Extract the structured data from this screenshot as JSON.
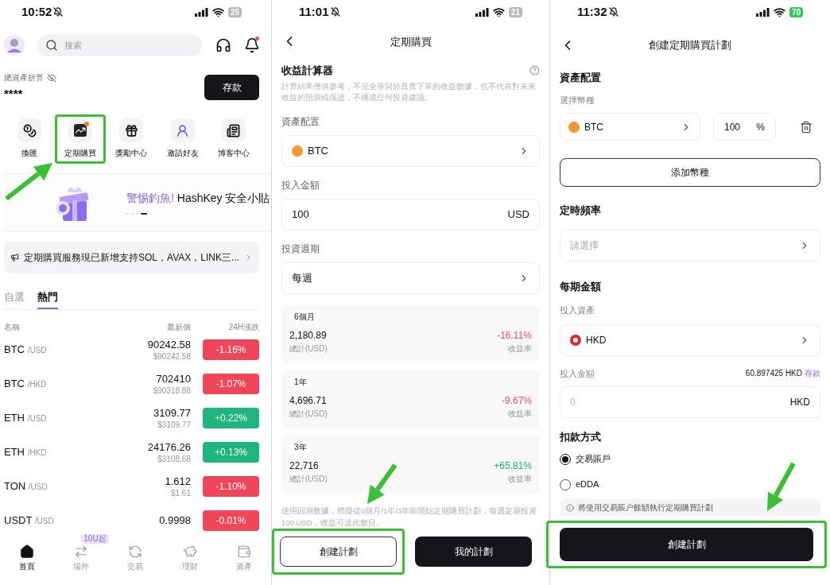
{
  "home_screen": {
    "status_bar": {
      "time": "10:52",
      "battery": "25",
      "charging": false
    },
    "search": {
      "placeholder": "搜索"
    },
    "bell_unread": true,
    "assets": {
      "label": "總資產折算",
      "value": "****",
      "deposit_button": "存款"
    },
    "shortcuts": [
      {
        "label": "換匯",
        "kind": "exchange",
        "highlighted": false
      },
      {
        "label": "定期購買",
        "kind": "recurring",
        "highlighted": true
      },
      {
        "label": "獎勵中心",
        "kind": "rewards",
        "highlighted": false
      },
      {
        "label": "邀請好友",
        "kind": "invite",
        "highlighted": false
      },
      {
        "label": "博客中心",
        "kind": "blog",
        "highlighted": false
      }
    ],
    "banner": {
      "accent": "警惕釣魚!",
      "text": "HashKey 安全小貼",
      "pager": [
        {
          "selected": false
        },
        {
          "selected": false
        },
        {
          "selected": false
        },
        {
          "selected": true
        }
      ]
    },
    "notice": "定期購買服務現已新增支持SOL，AVAX，LINK三...",
    "tabs": [
      {
        "label": "自選",
        "selected": false
      },
      {
        "label": "熱門",
        "selected": true
      }
    ],
    "table": {
      "columns": [
        "名稱",
        "最新價",
        "24H漲跌"
      ],
      "rows": [
        {
          "symbol": "BTC",
          "quote": "/USD",
          "price": "90242.58",
          "sub_price": "$90242.58",
          "change": "-1.16%",
          "rising": false
        },
        {
          "symbol": "BTC",
          "quote": "/HKD",
          "price": "702410",
          "sub_price": "$90318.88",
          "change": "-1.07%",
          "rising": false
        },
        {
          "symbol": "ETH",
          "quote": "/USD",
          "price": "3109.77",
          "sub_price": "$3109.77",
          "change": "+0.22%",
          "rising": true
        },
        {
          "symbol": "ETH",
          "quote": "/HKD",
          "price": "24176.26",
          "sub_price": "$3108.68",
          "change": "+0.13%",
          "rising": true
        },
        {
          "symbol": "TON",
          "quote": "/USD",
          "price": "1.612",
          "sub_price": "$1.61",
          "change": "-1.10%",
          "rising": false
        },
        {
          "symbol": "USDT",
          "quote": "/USD",
          "price": "0.9998",
          "change": "-0.01%",
          "rising": false
        }
      ]
    },
    "bottom_nav": [
      {
        "label": "首頁",
        "kind": "home",
        "selected": true
      },
      {
        "label": "場外",
        "kind": "otc",
        "selected": false,
        "badge": "10U起"
      },
      {
        "label": "交易",
        "kind": "trade",
        "selected": false
      },
      {
        "label": "理財",
        "kind": "finance",
        "selected": false
      },
      {
        "label": "資產",
        "kind": "assets",
        "selected": false
      }
    ]
  },
  "plan_screen": {
    "status_bar": {
      "time": "11:01",
      "battery": "21",
      "charging": false
    },
    "title": "定期購買",
    "calculator": {
      "title": "收益計算器",
      "disclaimer": "計算結果僅供參考，不完全等同於真實下單的收益數據，也不代表對未來收益的預測或保證，不構成任何投資建議。"
    },
    "fields": [
      {
        "label": "資產配置",
        "value": "BTC",
        "kind": "coin"
      },
      {
        "label": "投入金額",
        "value": "100",
        "unit": "USD",
        "kind": "amount"
      },
      {
        "label": "投資週期",
        "value": "每週",
        "kind": "select"
      }
    ],
    "results": [
      {
        "period": "6個月",
        "total": "2,180.89",
        "total_label": "總計(USD)",
        "rate": "-16.11%",
        "rising": false,
        "rate_label": "收益率"
      },
      {
        "period": "1年",
        "total": "4,696.71",
        "total_label": "總計(USD)",
        "rate": "-9.67%",
        "rising": false,
        "rate_label": "收益率"
      },
      {
        "period": "3年",
        "total": "22,716",
        "total_label": "總計(USD)",
        "rate": "+65.81%",
        "rising": true,
        "rate_label": "收益率"
      }
    ],
    "footnote": "使用回測數據，模擬從6個月/1年/3年前開始定期購買計劃，每週定期投資 100 USD，收益可達此數目。",
    "buttons": [
      {
        "label": "創建計劃",
        "kind": "outline",
        "highlighted": true
      },
      {
        "label": "我的計劃",
        "kind": "primary",
        "highlighted": false
      }
    ]
  },
  "create_screen": {
    "status_bar": {
      "time": "11:32",
      "battery": "70",
      "charging": true
    },
    "title": "創建定期購買計劃",
    "allocation": {
      "title": "資產配置",
      "label": "選擇幣種",
      "coin": "BTC",
      "percent": "100",
      "percent_unit": "%",
      "add_button": "添加幣種"
    },
    "frequency": {
      "title": "定時頻率",
      "placeholder": "請選擇"
    },
    "amount": {
      "title": "每期金額",
      "asset_label": "投入資產",
      "asset": "HKD",
      "amount_label": "投入金額",
      "balance": "60.897425 HKD",
      "deposit_link": "存款",
      "placeholder": "0",
      "unit": "HKD"
    },
    "payment": {
      "title": "扣款方式",
      "options": [
        {
          "label": "交易賬戶",
          "selected": true
        },
        {
          "label": "eDDA",
          "selected": false
        }
      ],
      "info": "將使用交易賬户餘額執行定期購買計劃"
    },
    "submit": {
      "label": "創建計劃",
      "highlighted": true
    }
  }
}
